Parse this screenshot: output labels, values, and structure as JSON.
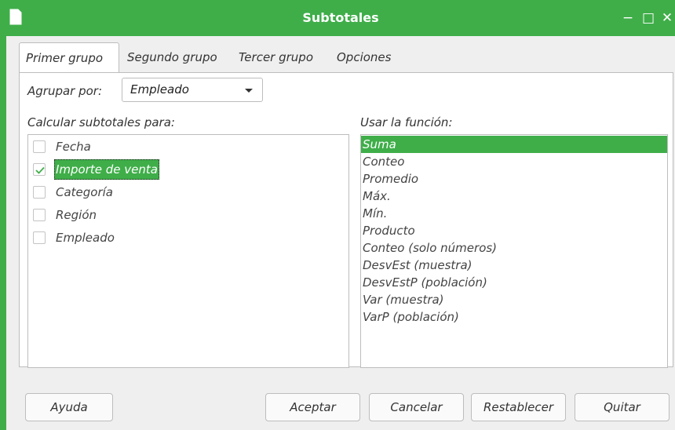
{
  "window": {
    "title": "Subtotales",
    "minimize": "−",
    "maximize": "□",
    "close": "✕",
    "icon": "document-icon"
  },
  "tabs": [
    {
      "label": "Primer grupo",
      "active": true
    },
    {
      "label": "Segundo grupo",
      "active": false
    },
    {
      "label": "Tercer grupo",
      "active": false
    },
    {
      "label": "Opciones",
      "active": false
    }
  ],
  "group_by": {
    "label": "Agrupar por:",
    "value": "Empleado"
  },
  "columns": {
    "label": "Calcular subtotales para:",
    "items": [
      {
        "label": "Fecha",
        "checked": false
      },
      {
        "label": "Importe de venta",
        "checked": true,
        "selected": true
      },
      {
        "label": "Categoría",
        "checked": false
      },
      {
        "label": "Región",
        "checked": false
      },
      {
        "label": "Empleado",
        "checked": false
      }
    ]
  },
  "functions": {
    "label": "Usar la función:",
    "items": [
      {
        "label": "Suma",
        "selected": true
      },
      {
        "label": "Conteo"
      },
      {
        "label": "Promedio"
      },
      {
        "label": "Máx."
      },
      {
        "label": "Mín."
      },
      {
        "label": "Producto"
      },
      {
        "label": "Conteo (solo números)"
      },
      {
        "label": "DesvEst (muestra)"
      },
      {
        "label": "DesvEstP (población)"
      },
      {
        "label": "Var (muestra)"
      },
      {
        "label": "VarP (población)"
      }
    ]
  },
  "buttons": {
    "help": "Ayuda",
    "ok": "Aceptar",
    "cancel": "Cancelar",
    "reset": "Restablecer",
    "remove": "Quitar"
  },
  "colors": {
    "accent": "#3fae49",
    "dialog_bg": "#efefef",
    "border": "#bdbdbd"
  }
}
